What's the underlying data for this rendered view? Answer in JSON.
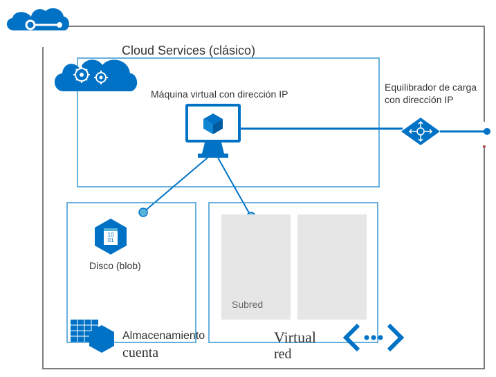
{
  "colors": {
    "azure_blue": "#0072C6",
    "light_blue": "#59B4D9",
    "border_blue": "#3896D3",
    "frame_gray": "#7D7D7D",
    "subnet_fill": "#E6E6E6",
    "text": "#333333",
    "dot_red": "#B24444"
  },
  "labels": {
    "cloud_services_title": "Cloud Services (clásico)",
    "vm_label": "Máquina virtual con dirección IP",
    "lb_label_line1": "Equilibrador de carga",
    "lb_label_line2": "con dirección IP",
    "disk_label": "Disco (blob)",
    "subnet_label": "Subred",
    "storage_label_line1": "Almacenamiento",
    "storage_label_line2": "cuenta",
    "vnet_label_line1": "Virtual",
    "vnet_label_line2": "red"
  }
}
